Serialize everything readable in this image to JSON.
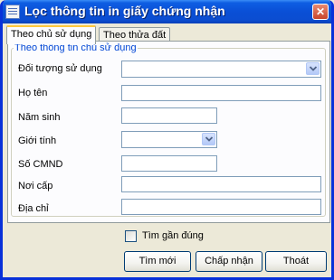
{
  "window": {
    "title": "Lọc thông tin in giấy chứng nhận",
    "close_glyph": "✕"
  },
  "tabs": [
    {
      "label": "Theo chủ sử dụng",
      "active": true
    },
    {
      "label": "Theo thửa đất",
      "active": false
    }
  ],
  "group": {
    "title": "Theo thông tin chủ sử dụng"
  },
  "fields": {
    "doi_tuong": {
      "label": "Đối tượng sử dụng",
      "value": ""
    },
    "ho_ten": {
      "label": "Họ tên",
      "value": ""
    },
    "nam_sinh": {
      "label": "Năm sinh",
      "value": ""
    },
    "gioi_tinh": {
      "label": "Giới tính",
      "value": ""
    },
    "so_cmnd": {
      "label": "Số CMND",
      "value": ""
    },
    "noi_cap": {
      "label": "Nơi cấp",
      "value": ""
    },
    "dia_chi": {
      "label": "Địa chỉ",
      "value": ""
    }
  },
  "options": {
    "approx_search_label": "Tìm gần đúng",
    "approx_search_checked": false
  },
  "buttons": {
    "new_label": "Tìm mới",
    "accept_label": "Chấp nhận",
    "exit_label": "Thoát"
  },
  "icons": {
    "app": "list-icon",
    "dropdown": "chevron-down-icon"
  }
}
